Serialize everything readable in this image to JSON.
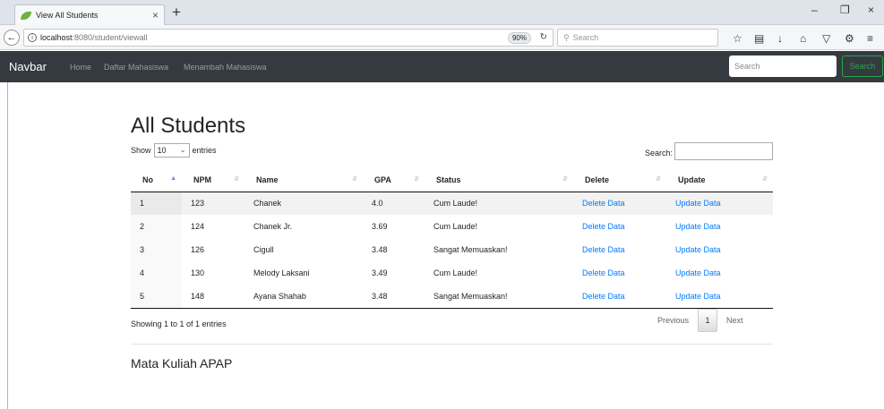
{
  "browser": {
    "tab_title": "View All Students",
    "tab_close": "×",
    "new_tab": "+",
    "url_host": "localhost",
    "url_path": ":8080/student/viewall",
    "zoom": "90%",
    "search_placeholder": "Search",
    "window_min": "–",
    "window_restore": "❐",
    "window_close": "×"
  },
  "navbar": {
    "brand": "Navbar",
    "links": [
      "Home",
      "Daftar Mahasiswa",
      "Menambah Mahasiswa"
    ],
    "search_placeholder": "Search",
    "search_button": "Search"
  },
  "page": {
    "title": "All Students",
    "show_label": "Show",
    "entries_value": "10",
    "entries_label": "entries",
    "search_label": "Search:",
    "info": "Showing 1 to 1 of 1 entries",
    "prev": "Previous",
    "page_num": "1",
    "next": "Next",
    "subtitle": "Mata Kuliah APAP"
  },
  "table": {
    "headers": [
      "No",
      "NPM",
      "Name",
      "GPA",
      "Status",
      "Delete",
      "Update"
    ],
    "rows": [
      {
        "no": "1",
        "npm": "123",
        "name": "Chanek",
        "gpa": "4.0",
        "status": "Cum Laude!",
        "delete": "Delete Data",
        "update": "Update Data"
      },
      {
        "no": "2",
        "npm": "124",
        "name": "Chanek Jr.",
        "gpa": "3.69",
        "status": "Cum Laude!",
        "delete": "Delete Data",
        "update": "Update Data"
      },
      {
        "no": "3",
        "npm": "126",
        "name": "Cigull",
        "gpa": "3.48",
        "status": "Sangat Memuaskan!",
        "delete": "Delete Data",
        "update": "Update Data"
      },
      {
        "no": "4",
        "npm": "130",
        "name": "Melody Laksani",
        "gpa": "3.49",
        "status": "Cum Laude!",
        "delete": "Delete Data",
        "update": "Update Data"
      },
      {
        "no": "5",
        "npm": "148",
        "name": "Ayana Shahab",
        "gpa": "3.48",
        "status": "Sangat Memuaskan!",
        "delete": "Delete Data",
        "update": "Update Data"
      }
    ]
  }
}
